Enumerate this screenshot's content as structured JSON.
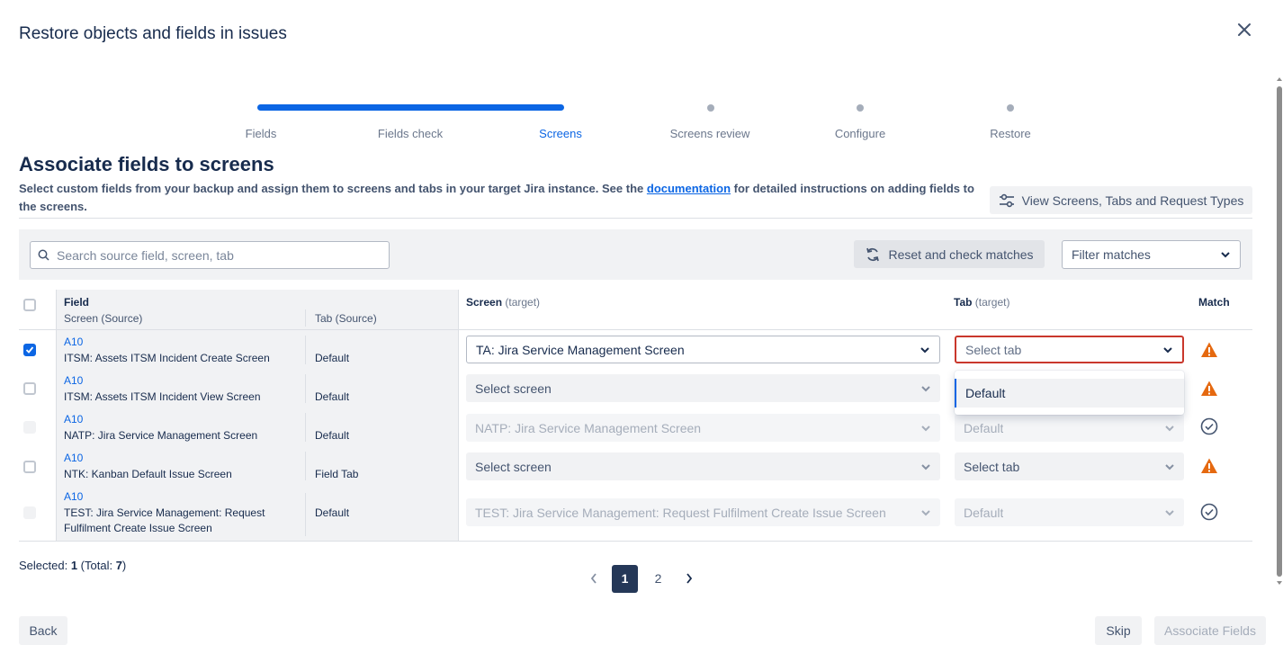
{
  "modal": {
    "title": "Restore objects and fields in issues",
    "close_icon": "close-icon"
  },
  "stepper": {
    "progress": 0.5,
    "steps": [
      {
        "label": "Fields",
        "state": "done"
      },
      {
        "label": "Fields check",
        "state": "done"
      },
      {
        "label": "Screens",
        "state": "active"
      },
      {
        "label": "Screens review",
        "state": "pending"
      },
      {
        "label": "Configure",
        "state": "pending"
      },
      {
        "label": "Restore",
        "state": "pending"
      }
    ]
  },
  "section": {
    "title": "Associate fields to screens",
    "desc_before": "Select custom fields from your backup and assign them to screens and tabs in your target Jira instance. See the ",
    "desc_link": "documentation",
    "desc_after": " for detailed instructions on adding fields to the screens."
  },
  "view_button": {
    "label": "View Screens, Tabs and Request Types",
    "icon": "settings-sliders-icon"
  },
  "toolbar": {
    "search_placeholder": "Search source field, screen, tab",
    "reset_label": "Reset and check matches",
    "filter_label": "Filter matches"
  },
  "table": {
    "headers": {
      "field": "Field",
      "screen_source": "Screen (Source)",
      "tab_source": "Tab (Source)",
      "screen_target": "Screen",
      "screen_target_suffix": "(target)",
      "tab_target": "Tab",
      "tab_target_suffix": "(target)",
      "match": "Match"
    },
    "rows": [
      {
        "field": "A10",
        "screen": "ITSM: Assets ITSM Incident Create Screen",
        "tab": "Default",
        "target_screen": "TA: Jira Service Management Screen",
        "target_tab": "Select tab",
        "checked": true,
        "match": "warning"
      },
      {
        "field": "A10",
        "screen": "ITSM: Assets ITSM Incident View Screen",
        "tab": "Default",
        "target_screen": "Select screen",
        "target_tab": "",
        "checked": false,
        "match": "warning"
      },
      {
        "field": "A10",
        "screen": "NATP: Jira Service Management Screen",
        "tab": "Default",
        "target_screen": "NATP: Jira Service Management Screen",
        "target_tab": "Default",
        "checked": false,
        "match": "ok"
      },
      {
        "field": "A10",
        "screen": "NTK: Kanban Default Issue Screen",
        "tab": "Field Tab",
        "target_screen": "Select screen",
        "target_tab": "Select tab",
        "checked": false,
        "match": "warning"
      },
      {
        "field": "A10",
        "screen_line1": "TEST: Jira Service Management: Request",
        "screen_line2": "Fulfilment Create Issue Screen",
        "tab": "Default",
        "target_screen": "TEST: Jira Service Management: Request Fulfilment Create Issue Screen",
        "target_tab": "Default",
        "checked": false,
        "match": "ok"
      }
    ],
    "dropdown_option": "Default"
  },
  "footer": {
    "selected_label": "Selected: ",
    "selected_count": "1",
    "total_open": " (Total: ",
    "total_count": "7",
    "total_close": ")",
    "pages": [
      "1",
      "2"
    ],
    "current_page": "1",
    "back_label": "Back",
    "skip_label": "Skip",
    "associate_label": "Associate Fields"
  },
  "colors": {
    "accent": "#0c66e4",
    "warning": "#e56910",
    "error_border": "#c9372c",
    "ok": "#44546f"
  }
}
